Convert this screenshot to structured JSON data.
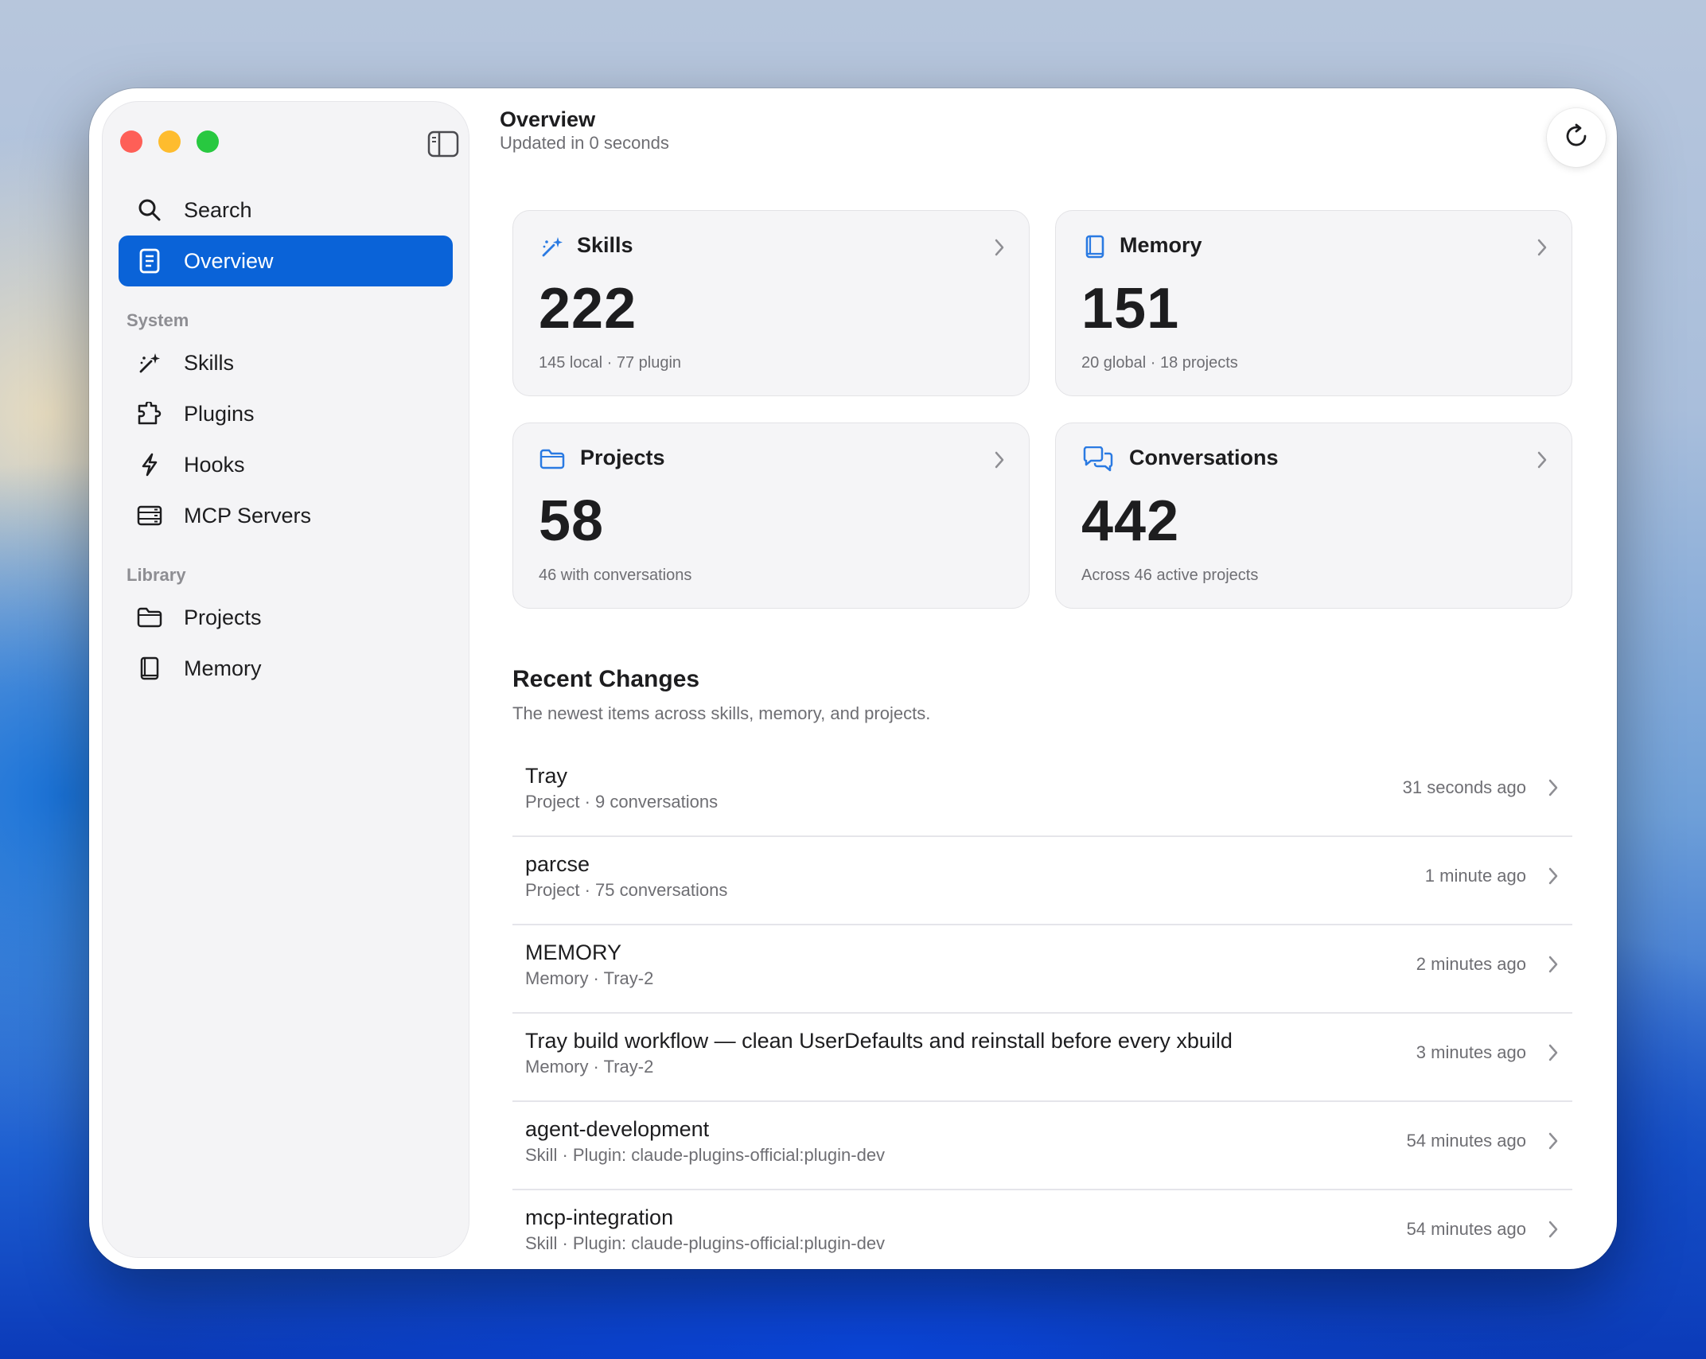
{
  "colors": {
    "accent": "#0a63d8",
    "icon_blue": "#2a7ae2",
    "traffic_red": "#fe5f57",
    "traffic_yellow": "#febc2e",
    "traffic_green": "#28c840"
  },
  "sidebar": {
    "search": {
      "label": "Search",
      "icon": "search-icon"
    },
    "overview": {
      "label": "Overview",
      "icon": "document-icon"
    },
    "system_label": "System",
    "system_items": [
      {
        "label": "Skills",
        "icon": "sparkles-wand-icon"
      },
      {
        "label": "Plugins",
        "icon": "puzzle-icon"
      },
      {
        "label": "Hooks",
        "icon": "bolt-icon"
      },
      {
        "label": "MCP Servers",
        "icon": "server-icon"
      }
    ],
    "library_label": "Library",
    "library_items": [
      {
        "label": "Projects",
        "icon": "folder-icon"
      },
      {
        "label": "Memory",
        "icon": "book-icon"
      }
    ]
  },
  "header": {
    "title": "Overview",
    "subtitle": "Updated in 0 seconds",
    "refresh_icon": "refresh-icon"
  },
  "cards": [
    {
      "title": "Skills",
      "value": "222",
      "desc": "145 local · 77 plugin",
      "icon": "sparkles-wand-icon"
    },
    {
      "title": "Memory",
      "value": "151",
      "desc": "20 global · 18 projects",
      "icon": "book-icon"
    },
    {
      "title": "Projects",
      "value": "58",
      "desc": "46 with conversations",
      "icon": "folder-icon"
    },
    {
      "title": "Conversations",
      "value": "442",
      "desc": "Across 46 active projects",
      "icon": "chat-bubbles-icon"
    }
  ],
  "recent": {
    "title": "Recent Changes",
    "subtitle": "The newest items across skills, memory, and projects.",
    "rows": [
      {
        "title": "Tray",
        "sub": "Project · 9 conversations",
        "time": "31 seconds ago"
      },
      {
        "title": "parcse",
        "sub": "Project · 75 conversations",
        "time": "1 minute ago"
      },
      {
        "title": "MEMORY",
        "sub": "Memory · Tray-2",
        "time": "2 minutes ago"
      },
      {
        "title": "Tray build workflow — clean UserDefaults and reinstall before every xbuild",
        "sub": "Memory · Tray-2",
        "time": "3 minutes ago"
      },
      {
        "title": "agent-development",
        "sub": "Skill · Plugin: claude-plugins-official:plugin-dev",
        "time": "54 minutes ago"
      },
      {
        "title": "mcp-integration",
        "sub": "Skill · Plugin: claude-plugins-official:plugin-dev",
        "time": "54 minutes ago"
      }
    ]
  }
}
